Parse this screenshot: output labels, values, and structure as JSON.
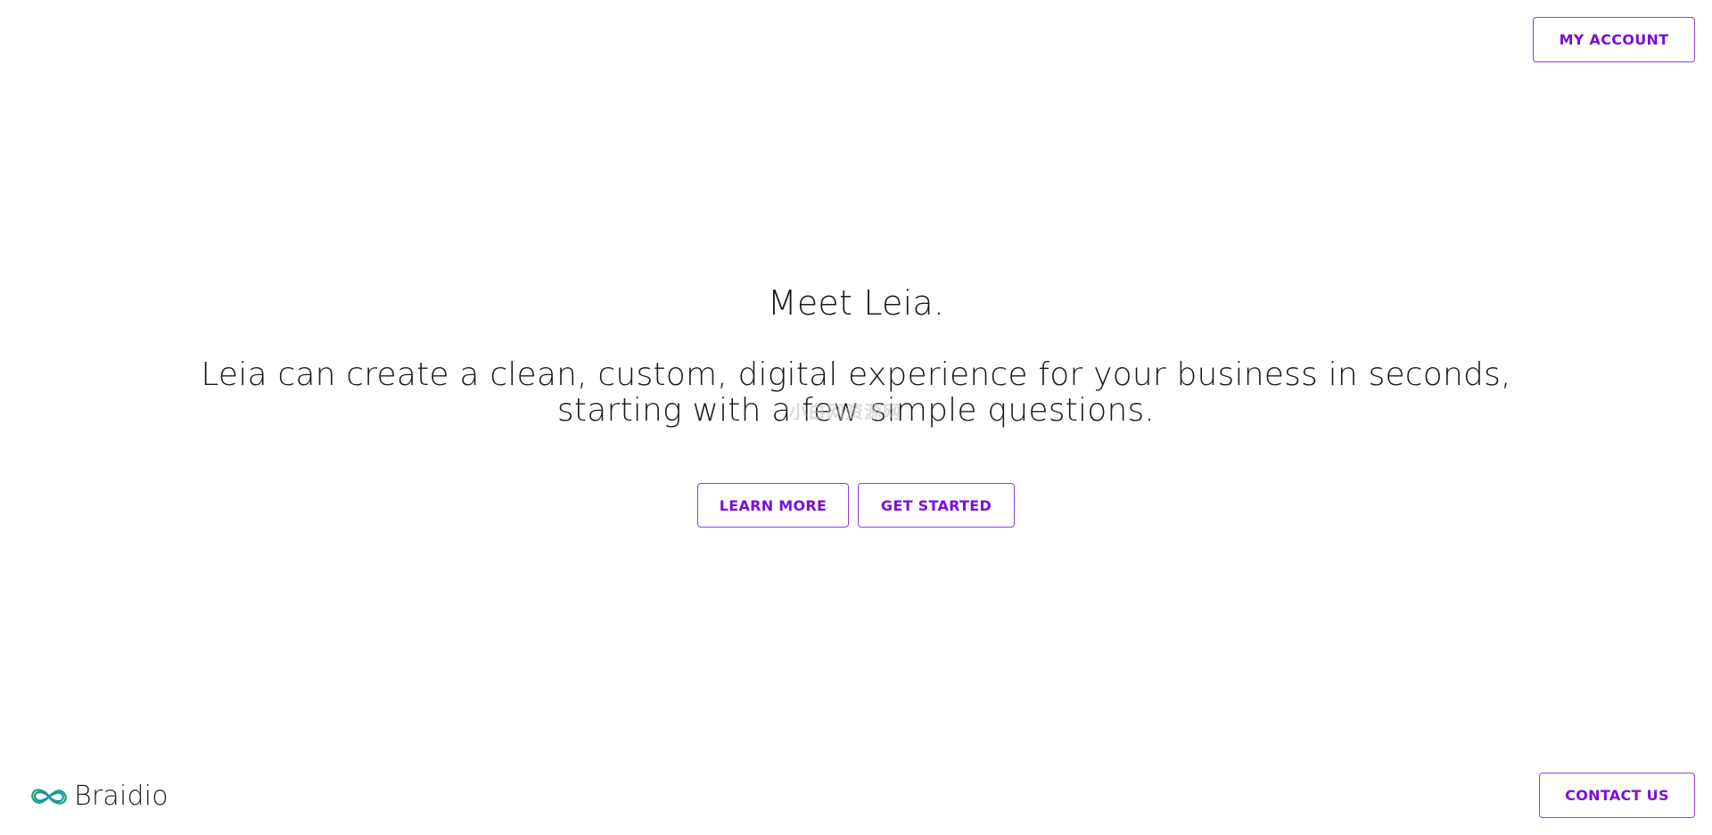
{
  "header": {
    "account_label": "MY ACCOUNT"
  },
  "hero": {
    "title": "Meet Leia.",
    "subtitle_line1": "Leia can create a clean, custom, digital experience for your business in seconds,",
    "subtitle_line2": "starting with a few simple questions.",
    "learn_more_label": "LEARN MORE",
    "get_started_label": "GET STARTED"
  },
  "watermark": "小白网资源网",
  "footer": {
    "logo_text": "Braidio",
    "logo_icon": "infinity-braid-icon",
    "contact_label": "CONTACT US"
  },
  "colors": {
    "accent": "#7a0fd9",
    "button_border": "#8e44d6",
    "logo_green": "#1faa6b",
    "logo_teal": "#1a8fb0"
  }
}
